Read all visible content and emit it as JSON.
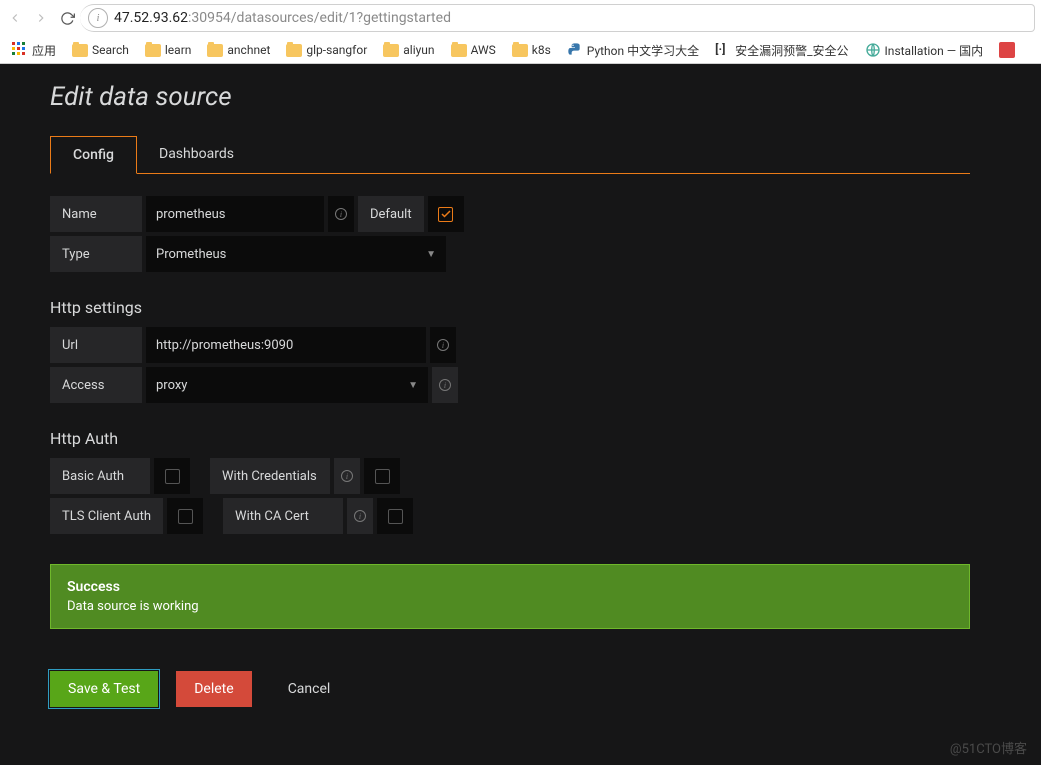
{
  "browser": {
    "url_host": "47.52.93.62",
    "url_port": ":30954",
    "url_path": "/datasources/edit/1?gettingstarted",
    "bookmarks": [
      "应用",
      "Search",
      "learn",
      "anchnet",
      "glp-sangfor",
      "aliyun",
      "AWS",
      "k8s",
      "Python 中文学习大全",
      "安全漏洞预警_安全公",
      "Installation — 国内"
    ]
  },
  "page": {
    "title": "Edit data source",
    "tabs": [
      {
        "label": "Config",
        "active": true
      },
      {
        "label": "Dashboards",
        "active": false
      }
    ],
    "fields": {
      "name": {
        "label": "Name",
        "value": "prometheus"
      },
      "default": {
        "label": "Default",
        "checked": true
      },
      "type": {
        "label": "Type",
        "value": "Prometheus"
      }
    },
    "http_settings": {
      "heading": "Http settings",
      "url": {
        "label": "Url",
        "value": "http://prometheus:9090"
      },
      "access": {
        "label": "Access",
        "value": "proxy"
      }
    },
    "http_auth": {
      "heading": "Http Auth",
      "basic": {
        "label": "Basic Auth",
        "checked": false
      },
      "with_cred": {
        "label": "With Credentials",
        "checked": false
      },
      "tls": {
        "label": "TLS Client Auth",
        "checked": false
      },
      "ca": {
        "label": "With CA Cert",
        "checked": false
      }
    },
    "alert": {
      "title": "Success",
      "msg": "Data source is working"
    },
    "buttons": {
      "save": "Save & Test",
      "delete": "Delete",
      "cancel": "Cancel"
    },
    "watermark": "@51CTO博客"
  }
}
